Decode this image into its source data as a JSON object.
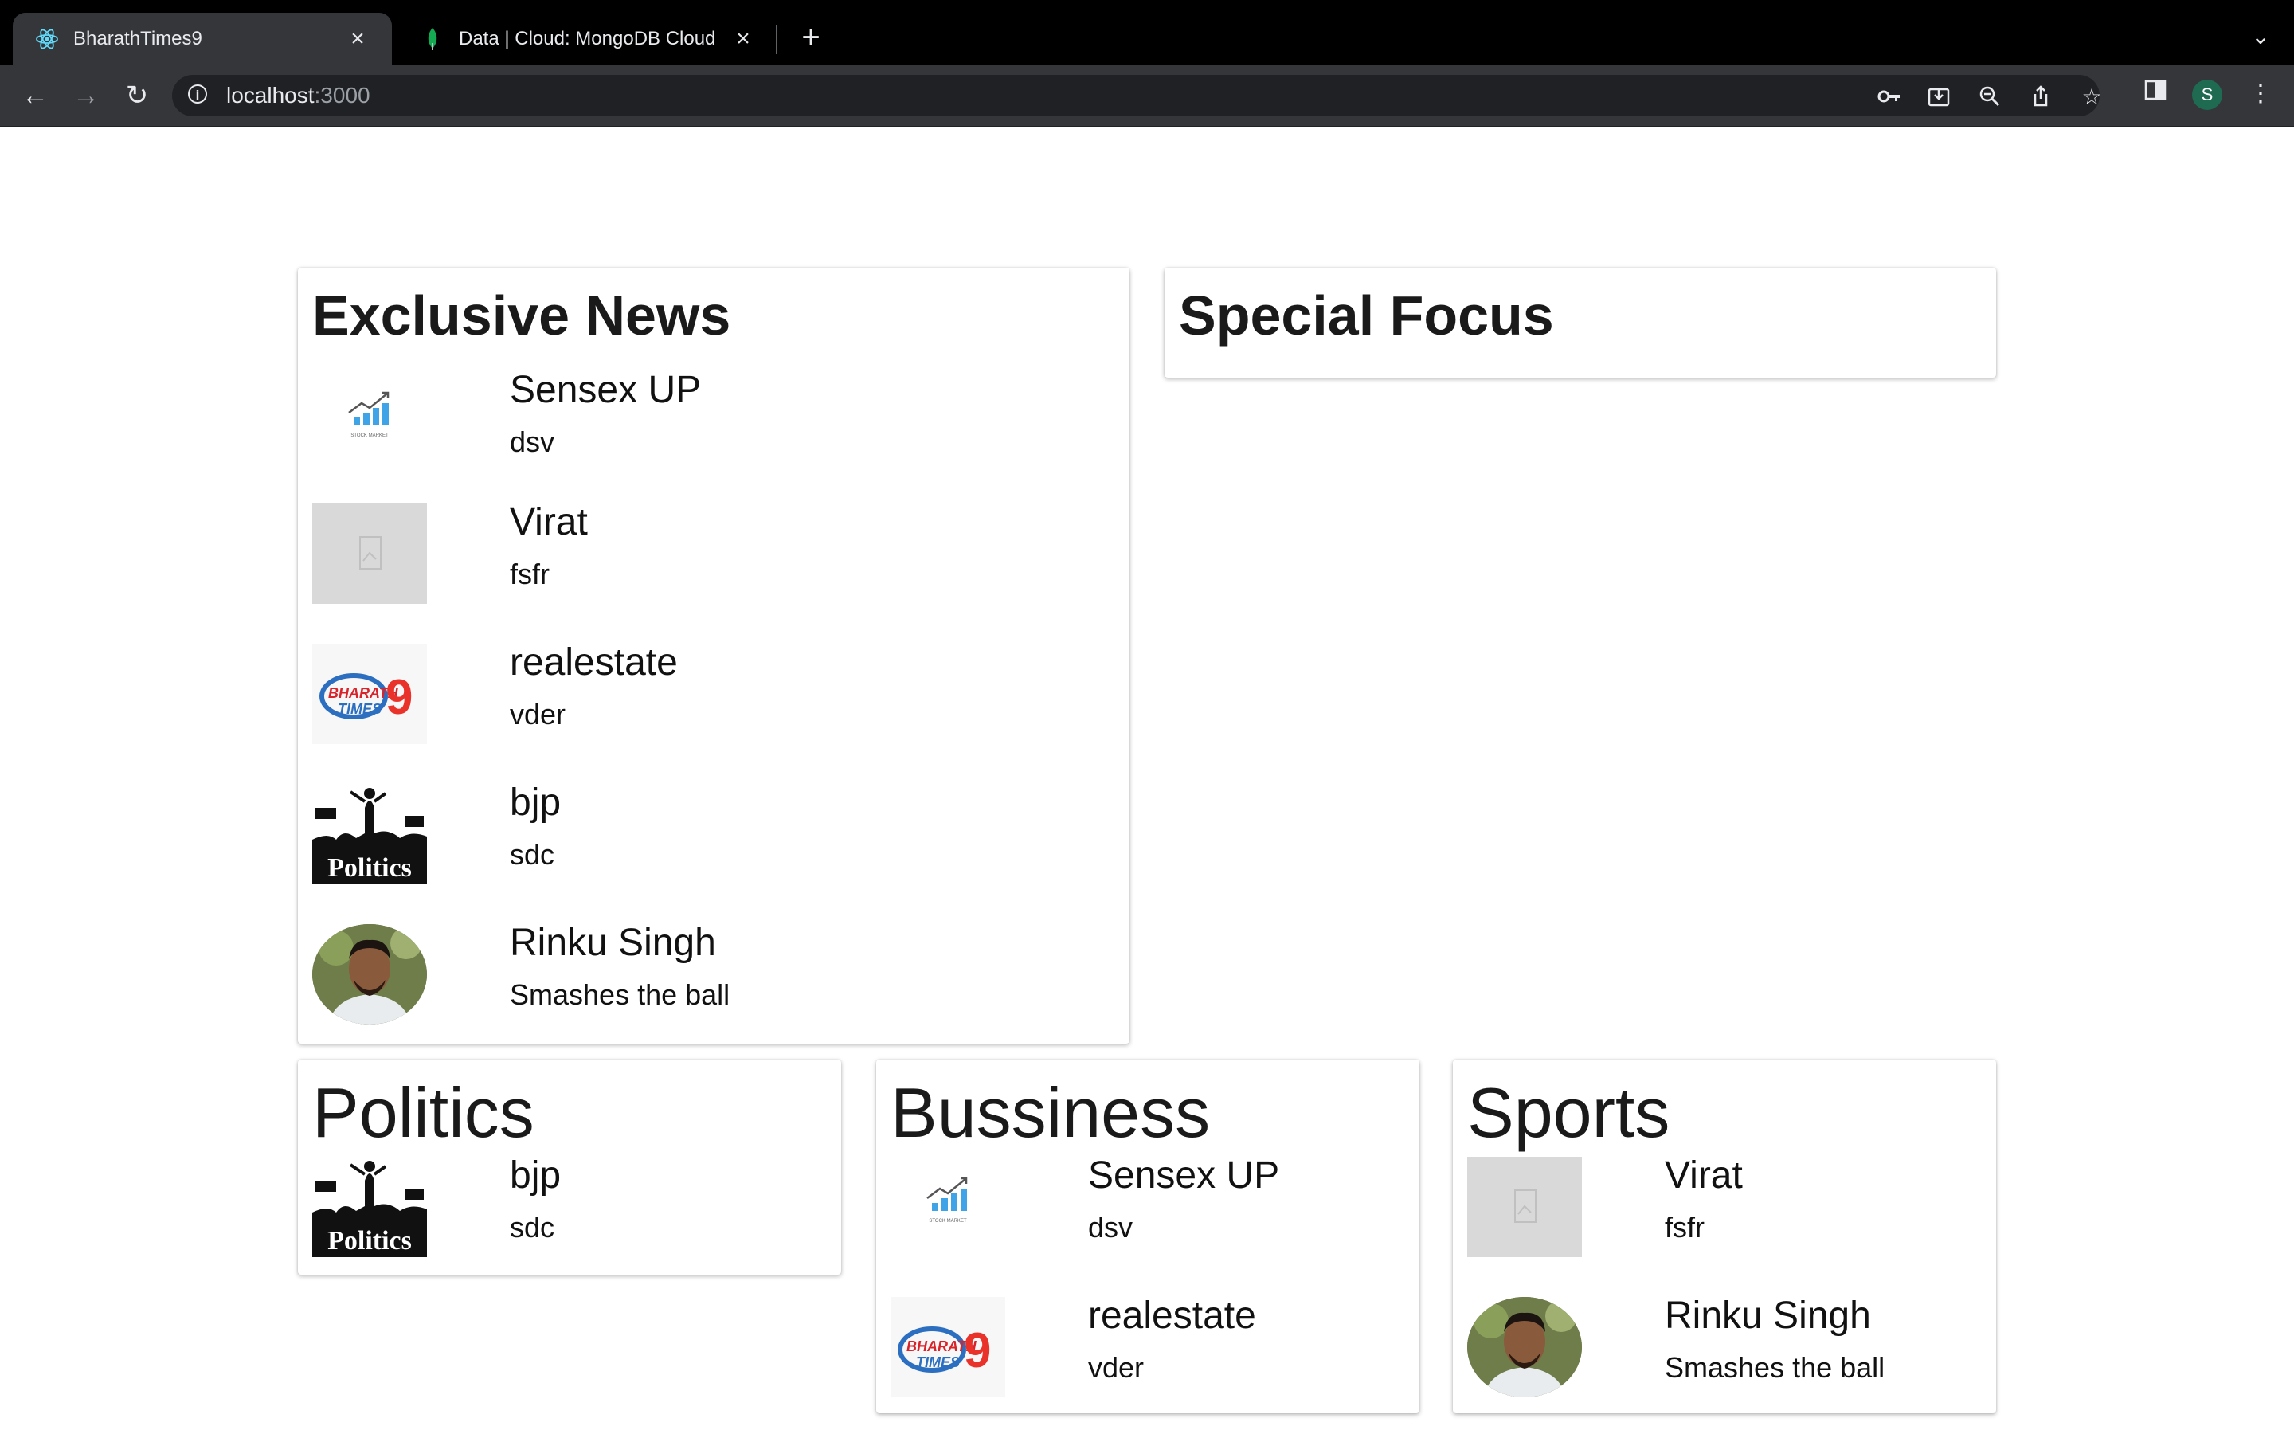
{
  "browser": {
    "tabs": [
      {
        "title": "BharathTimes9",
        "icon": "react-icon",
        "active": true
      },
      {
        "title": "Data | Cloud: MongoDB Cloud",
        "icon": "mongodb-leaf-icon",
        "active": false
      }
    ],
    "url_host": "localhost",
    "url_port": ":3000",
    "profile_initial": "S"
  },
  "exclusive": {
    "heading": "Exclusive News",
    "items": [
      {
        "title": "Sensex UP",
        "sub": "dsv",
        "image": "stock-market"
      },
      {
        "title": "Virat",
        "sub": "fsfr",
        "image": "broken"
      },
      {
        "title": "realestate",
        "sub": "vder",
        "image": "bharath-times-logo"
      },
      {
        "title": "bjp",
        "sub": "sdc",
        "image": "politics"
      },
      {
        "title": "Rinku Singh",
        "sub": "Smashes the ball",
        "image": "portrait"
      }
    ]
  },
  "special": {
    "heading": "Special Focus"
  },
  "politics": {
    "heading": "Politics",
    "items": [
      {
        "title": "bjp",
        "sub": "sdc",
        "image": "politics"
      }
    ]
  },
  "business": {
    "heading": "Bussiness",
    "items": [
      {
        "title": "Sensex UP",
        "sub": "dsv",
        "image": "stock-market"
      },
      {
        "title": "realestate",
        "sub": "vder",
        "image": "bharath-times-logo"
      }
    ]
  },
  "sports": {
    "heading": "Sports",
    "items": [
      {
        "title": "Virat",
        "sub": "fsfr",
        "image": "broken"
      },
      {
        "title": "Rinku Singh",
        "sub": "Smashes the ball",
        "image": "portrait"
      }
    ]
  },
  "image_texts": {
    "stock_caption": "STOCK MARKET",
    "politics_caption": "Politics",
    "logo_line1": "BHARATH",
    "logo_line2": "TIMES",
    "logo_num": "9"
  }
}
